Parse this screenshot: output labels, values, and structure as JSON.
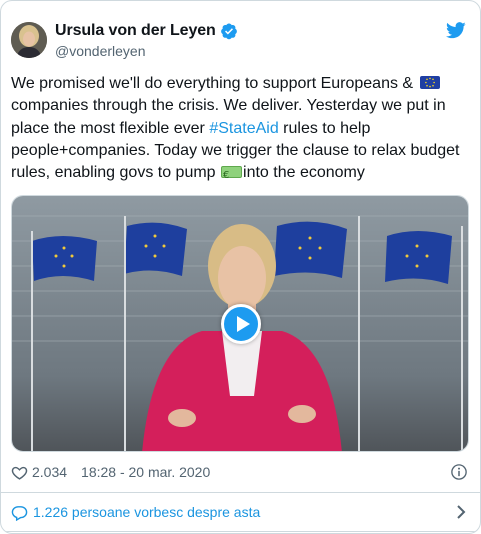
{
  "author": {
    "display_name": "Ursula von der Leyen",
    "handle": "@vonderleyen",
    "verified": true
  },
  "tweet": {
    "text_1": "We promised we'll do everything to support Europeans &",
    "emoji_1": "eu-flag-emoji",
    "text_2": " companies through the crisis. We deliver. Yesterday we put in place the most flexible ever ",
    "hashtag": "#StateAid",
    "text_3": " rules to help people+companies. Today we trigger the clause to relax budget rules, enabling govs to pump",
    "emoji_2": "euro-banknote-emoji",
    "text_4": "into the economy"
  },
  "media": {
    "type": "video",
    "play_icon": "play-icon"
  },
  "meta": {
    "likes": "2.034",
    "timestamp": "18:28 - 20 mar. 2020"
  },
  "conversation": {
    "label": "1.226 persoane vorbesc despre asta"
  },
  "colors": {
    "link": "#1b95e0",
    "twitter_blue": "#1d9bf0",
    "muted": "#536471",
    "border": "#cfd9de",
    "blazer": "#d41f5b",
    "eu_blue": "#1f3fa3"
  },
  "icons": [
    "verified-badge-icon",
    "twitter-bird-icon",
    "heart-icon",
    "info-icon",
    "speech-bubble-icon",
    "chevron-right-icon"
  ]
}
